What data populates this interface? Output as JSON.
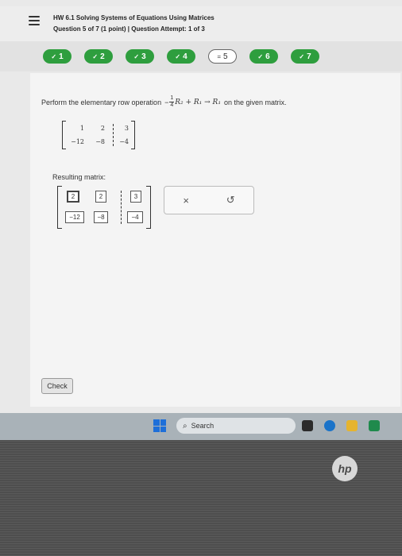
{
  "header": {
    "title": "HW 6.1 Solving Systems of Equations Using Matrices",
    "subtitle": "Question 5 of 7 (1 point) | Question Attempt: 1 of 3"
  },
  "questions": [
    {
      "label": "1",
      "status": "done"
    },
    {
      "label": "2",
      "status": "done"
    },
    {
      "label": "3",
      "status": "done"
    },
    {
      "label": "4",
      "status": "done"
    },
    {
      "label": "5",
      "status": "current"
    },
    {
      "label": "6",
      "status": "done"
    },
    {
      "label": "7",
      "status": "done"
    }
  ],
  "problem": {
    "prefix": "Perform the elementary row operation",
    "minus": "−",
    "frac_num": "1",
    "frac_den": "4",
    "operation": "R₂ + R₁ → R₁",
    "suffix": "on the given matrix."
  },
  "original_matrix": {
    "row1": [
      "1",
      "2",
      "3"
    ],
    "row2": [
      "−12",
      "−8",
      "−4"
    ]
  },
  "result": {
    "label": "Resulting matrix:",
    "row1": [
      "2",
      "2",
      "3"
    ],
    "row2": [
      "−12",
      "−8",
      "−4"
    ]
  },
  "tools": {
    "clear": "×",
    "undo": "↺"
  },
  "check_label": "Check",
  "taskbar": {
    "search_placeholder": "Search"
  },
  "brand": "hp",
  "colors": {
    "done": "#2e9e3e",
    "current_bg": "#ffffff"
  }
}
